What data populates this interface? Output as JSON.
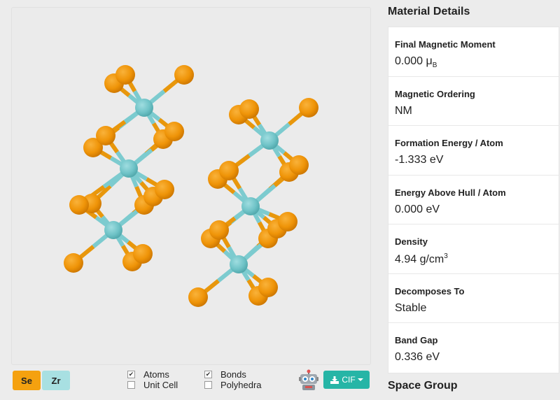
{
  "viewer": {
    "description": "ZrSe2 crystal structure"
  },
  "toolbar": {
    "elements": [
      {
        "symbol": "Se",
        "color": "#f5a10f"
      },
      {
        "symbol": "Zr",
        "color": "#a8e0e2"
      }
    ],
    "toggles": {
      "atoms": {
        "label": "Atoms",
        "checked": true
      },
      "unit_cell": {
        "label": "Unit Cell",
        "checked": false
      },
      "bonds": {
        "label": "Bonds",
        "checked": true
      },
      "polyhedra": {
        "label": "Polyhedra",
        "checked": false
      }
    },
    "robot_icon": "robot-icon",
    "download": {
      "label": "CIF",
      "icon": "download-icon",
      "caret": "caret-down-icon"
    }
  },
  "details": {
    "title": "Material Details",
    "properties": [
      {
        "label": "Final Magnetic Moment",
        "value": "0.000 μ",
        "sub": "B",
        "sup": ""
      },
      {
        "label": "Magnetic Ordering",
        "value": "NM",
        "sub": "",
        "sup": ""
      },
      {
        "label": "Formation Energy / Atom",
        "value": "-1.333 eV",
        "sub": "",
        "sup": ""
      },
      {
        "label": "Energy Above Hull / Atom",
        "value": "0.000 eV",
        "sub": "",
        "sup": ""
      },
      {
        "label": "Density",
        "value": "4.94 g/cm",
        "sub": "",
        "sup": "3"
      },
      {
        "label": "Decomposes To",
        "value": "Stable",
        "sub": "",
        "sup": ""
      },
      {
        "label": "Band Gap",
        "value": "0.336 eV",
        "sub": "",
        "sup": ""
      }
    ]
  },
  "space_group": {
    "title": "Space Group"
  }
}
